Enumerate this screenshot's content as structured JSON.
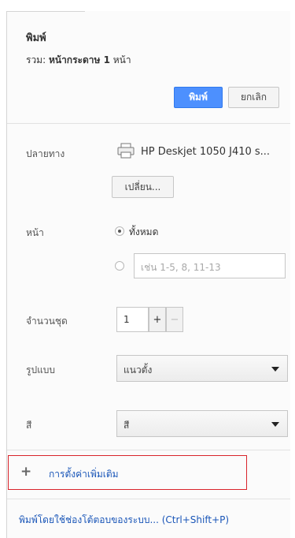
{
  "header": {
    "title": "พิมพ์",
    "summary_prefix": "รวม: ",
    "summary_value": "หน้ากระดาษ 1",
    "summary_suffix": " หน้า",
    "print_button": "พิมพ์",
    "cancel_button": "ยกเลิก"
  },
  "destination": {
    "label": "ปลายทาง",
    "printer_icon": "printer-icon",
    "printer_name": "HP Deskjet 1050 J410 s...",
    "change_button": "เปลี่ยน..."
  },
  "pages": {
    "label": "หน้า",
    "option_all": "ทั้งหมด",
    "selected": "all",
    "range_placeholder": "เช่น 1-5, 8, 11-13"
  },
  "copies": {
    "label": "จำนวนชุด",
    "value": "1",
    "plus": "+",
    "minus": "−"
  },
  "layout": {
    "label": "รูปแบบ",
    "value": "แนวตั้ง"
  },
  "color": {
    "label": "สี",
    "value": "สี"
  },
  "more_settings": {
    "icon": "+",
    "label": "การตั้งค่าเพิ่มเติม",
    "highlight_color": "#d9242b"
  },
  "system_dialog": {
    "label": "พิมพ์โดยใช้ช่องโต้ตอบของระบบ... (Ctrl+Shift+P)"
  },
  "colors": {
    "accent": "#4d90fe",
    "link": "#1a56b8"
  }
}
